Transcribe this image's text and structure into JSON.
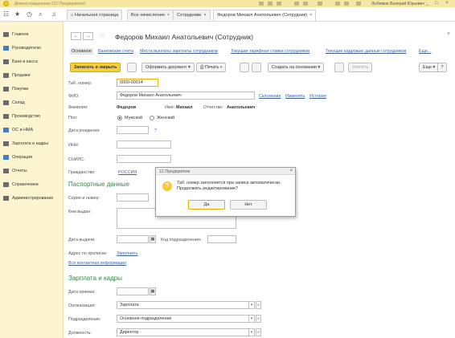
{
  "titlebar": {
    "title": "Демонстрационная (1С:Предприятие)",
    "user": "Любимов Валерий Юрьевич"
  },
  "tabs": [
    {
      "label": "Начальная страница"
    },
    {
      "label": "Все начисления"
    },
    {
      "label": "Сотрудники"
    },
    {
      "label": "Федоров Михаил Анатольевич (Сотрудник)"
    }
  ],
  "sidebar": {
    "items": [
      {
        "label": "Главное",
        "icon": "menu-icon"
      },
      {
        "label": "Руководителю",
        "icon": "chart-line-icon"
      },
      {
        "label": "Банк и касса",
        "icon": "bank-icon"
      },
      {
        "label": "Продажи",
        "icon": "cart-icon"
      },
      {
        "label": "Покупки",
        "icon": "basket-icon"
      },
      {
        "label": "Склад",
        "icon": "warehouse-icon"
      },
      {
        "label": "Производство",
        "icon": "factory-icon"
      },
      {
        "label": "ОС и НМА",
        "icon": "asset-icon"
      },
      {
        "label": "Зарплата и кадры",
        "icon": "people-icon"
      },
      {
        "label": "Операции",
        "icon": "operations-icon"
      },
      {
        "label": "Отчеты",
        "icon": "report-icon"
      },
      {
        "label": "Справочники",
        "icon": "book-icon"
      },
      {
        "label": "Администрирование",
        "icon": "gear-icon"
      }
    ]
  },
  "doc": {
    "title": "Федоров Михаил Анатольевич (Сотрудник)",
    "close": "×"
  },
  "links": [
    "Основное",
    "Банковские счета",
    "Места выплаты зарплаты сотрудников",
    "Текущая тарифная ставка сотрудников",
    "Текущие кадровые данные сотрудников",
    "Еще..."
  ],
  "toolbar": {
    "save_close": "Записать и закрыть",
    "create_doc": "Оформить документ",
    "print": "Печать",
    "create_based": "Создать на основании",
    "delete": "Уволить",
    "more": "Еще",
    "help": "?"
  },
  "form": {
    "tab_no_label": "Таб. номер:",
    "tab_no_value": "0000-00014",
    "fio_label": "ФИО:",
    "fio_value": "Федоров Михаил Анатольевич",
    "fio_links": [
      "Склонения",
      "Изменить",
      "История"
    ],
    "surname_label": "Фамилия:",
    "surname_value": "Федоров",
    "name_label": "Имя:",
    "name_value": "Михаил",
    "patronymic_label": "Отчество:",
    "patronymic_value": "Анатольевич",
    "gender_label": "Пол:",
    "gender_male": "Мужской",
    "gender_female": "Женский",
    "birth_label": "Дата рождения:",
    "birth_value": ". .",
    "birth_help": "?",
    "inn_label": "ИНН:",
    "snils_label": "СНИЛС:",
    "snils_value": "- -",
    "citizenship_label": "Гражданство:",
    "citizenship_value": "РОССИЯ",
    "passport_section": "Паспортные данные",
    "series_label": "Серия и номер:",
    "issued_by_label": "Кем выдан:",
    "issue_date_label": "Дата выдачи:",
    "issue_date_value": ". .",
    "division_code_label": "Код подразделения:",
    "address_label": "Адрес по прописке:",
    "address_link": "Заполнить",
    "contact_link": "Вся контактная информация",
    "salary_section": "Зарплата и кадры",
    "hire_date_label": "Дата приема:",
    "hire_date_value": ". .",
    "org_label": "Организация:",
    "org_value": "Зарплата",
    "dept_label": "Подразделение:",
    "dept_value": "Основное подразделение",
    "position_label": "Должность:",
    "position_value": "Директор"
  },
  "dialog": {
    "title": "1С:Предприятие",
    "message": "Таб. номер заполняется при записи автоматически. Продолжить редактирование?",
    "yes": "Да",
    "no": "Нет"
  },
  "colors": {
    "accent_yellow": "#f6d03c",
    "section_green": "#2f8a40",
    "link_blue": "#3d5fa3",
    "sidebar_bg": "#fcf5d0"
  }
}
